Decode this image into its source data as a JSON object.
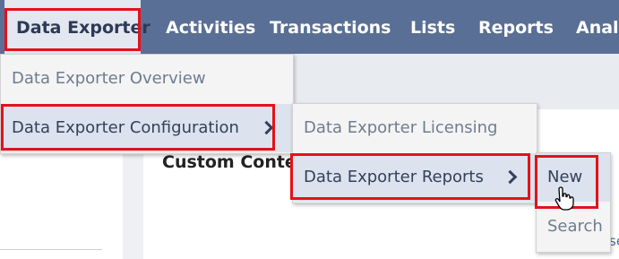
{
  "nav": {
    "items": [
      {
        "label": "Data Exporter"
      },
      {
        "label": "Activities"
      },
      {
        "label": "Transactions"
      },
      {
        "label": "Lists"
      },
      {
        "label": "Reports"
      },
      {
        "label": "Analy"
      }
    ]
  },
  "page": {
    "custom_content_title": "Custom Content",
    "partial_text": "se"
  },
  "menu1": {
    "items": [
      {
        "label": "Data Exporter Overview"
      },
      {
        "label": "Data Exporter Configuration"
      }
    ]
  },
  "menu2": {
    "items": [
      {
        "label": "Data Exporter Licensing"
      },
      {
        "label": "Data Exporter Reports"
      }
    ]
  },
  "menu3": {
    "items": [
      {
        "label": "New"
      },
      {
        "label": "Search"
      }
    ]
  },
  "colors": {
    "nav_background": "#5a6f95",
    "highlight_border": "#e3121a",
    "menu_highlight": "#dce3ee"
  },
  "icons": {
    "submenu_indicator": "chevron-right-icon",
    "pointer": "hand-cursor-icon"
  }
}
